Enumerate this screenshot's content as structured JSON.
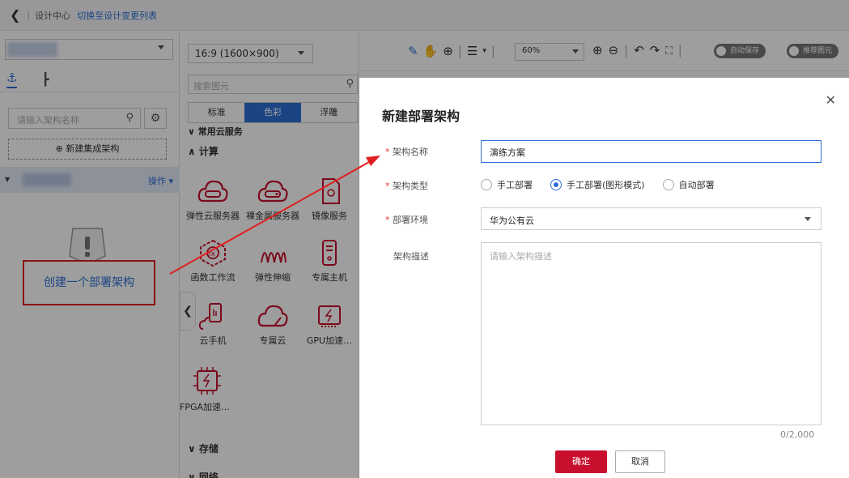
{
  "topbar": {
    "back_icon": "chevron-left-icon",
    "design_center": "设计中心",
    "switch_link": "切换至设计变更列表"
  },
  "left_panel": {
    "search_placeholder": "请输入架构名称",
    "new_arch_label": "⊕ 新建集成架构",
    "row_action": "操作 ▾",
    "empty_link": "创建一个部署架构"
  },
  "element_panel": {
    "ratio": "16:9 (1600×900)",
    "search_placeholder": "搜索图元",
    "style_tabs": [
      "标准",
      "色彩",
      "浮雕"
    ],
    "category_common": "∨ 常用云服务",
    "category_compute": "∧ 计算",
    "services": [
      "弹性云服务器",
      "裸金属服务器",
      "镜像服务",
      "函数工作流",
      "弹性伸缩",
      "专属主机",
      "云手机",
      "专属云",
      "GPU加速…",
      "FPGA加速…"
    ],
    "category_storage": "∨ 存储",
    "category_network": "∨ 网络"
  },
  "toolbar": {
    "zoom": "60%",
    "autosave_label": "自动保存",
    "recommend_label": "推荐图元"
  },
  "dialog": {
    "title": "新建部署架构",
    "name_label": "架构名称",
    "name_value": "演练方案",
    "type_label": "架构类型",
    "type_options": [
      "手工部署",
      "手工部署(图形模式)",
      "自动部署"
    ],
    "type_selected": 1,
    "env_label": "部署环境",
    "env_value": "华为公有云",
    "desc_label": "架构描述",
    "desc_placeholder": "请输入架构描述",
    "desc_counter": "0/2,000",
    "ok_label": "确定",
    "cancel_label": "取消"
  },
  "colors": {
    "primary": "#2d6fd6",
    "danger": "#c8102e",
    "annotation": "#e02020"
  }
}
